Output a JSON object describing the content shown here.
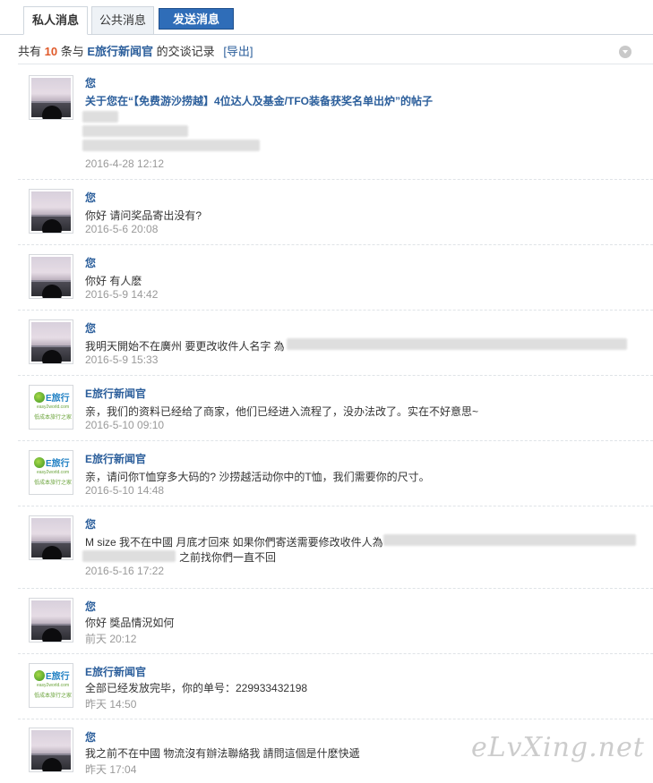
{
  "tabs": {
    "private": "私人消息",
    "public": "公共消息",
    "send": "发送消息"
  },
  "summary": {
    "prefix": "共有",
    "count": "10",
    "middle": "条与",
    "partner": "E旅行新闻官",
    "suffix": "的交谈记录",
    "export": "[导出]"
  },
  "messages": [
    {
      "author": "您",
      "text": "关于您在“【免费游沙捞越】4位达人及基金/TFO装备获奖名单出炉”的帖子",
      "time": "2016-4-28 12:12",
      "avatar": "user-photo"
    },
    {
      "author": "您",
      "text": "你好  请问奖品寄出没有?",
      "time": "2016-5-6 20:08",
      "avatar": "user-photo"
    },
    {
      "author": "您",
      "text": "你好  有人麽",
      "time": "2016-5-9 14:42",
      "avatar": "user-photo"
    },
    {
      "author": "您",
      "text": "我明天開始不在廣州  要更改收件人名字 為",
      "time": "2016-5-9 15:33",
      "avatar": "user-photo"
    },
    {
      "author": "E旅行新闻官",
      "text": "亲，我们的资料已经给了商家，他们已经进入流程了，没办法改了。实在不好意思~",
      "time": "2016-5-10 09:10",
      "avatar": "elvxing-logo"
    },
    {
      "author": "E旅行新闻官",
      "text": "亲，请问你T恤穿多大码的? 沙捞越活动你中的T恤，我们需要你的尺寸。",
      "time": "2016-5-10 14:48",
      "avatar": "elvxing-logo"
    },
    {
      "author": "您",
      "text": "M size 我不在中國 月底才回來 如果你們寄送需要修改收件人為",
      "text2": "之前找你們一直不回",
      "time": "2016-5-16 17:22",
      "avatar": "user-photo"
    },
    {
      "author": "您",
      "text": "你好  獎品情況如何",
      "time": "前天 20:12",
      "avatar": "user-photo"
    },
    {
      "author": "E旅行新闻官",
      "text": "全部已经发放完毕，你的单号：229933432198",
      "time": "昨天 14:50",
      "avatar": "elvxing-logo"
    },
    {
      "author": "您",
      "text": "我之前不在中國  物流沒有辦法聯絡我  請問這個是什麽快遞",
      "time": "昨天 17:04",
      "avatar": "user-photo"
    }
  ],
  "logo": {
    "brand": "E旅行",
    "site": "easy2world.com",
    "slogan": "低成本旅行之家"
  },
  "watermark": "eLvXing.net",
  "colors": {
    "link": "#2b5e9b",
    "accent": "#e05a2a",
    "button": "#2f6db8",
    "time": "#999999"
  }
}
